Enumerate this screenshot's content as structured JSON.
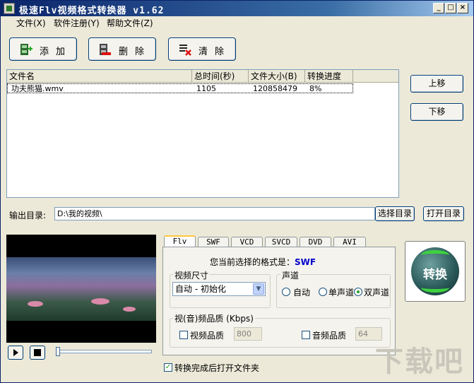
{
  "window": {
    "title": "极速Flv视频格式转换器 v1.62",
    "controls": {
      "minimize": "_",
      "maximize": "□",
      "close": "×"
    }
  },
  "menu": [
    {
      "label": "文件(X)"
    },
    {
      "label": "软件注册(Y)"
    },
    {
      "label": "帮助文件(Z)"
    }
  ],
  "toolbar": {
    "add_label": "添加",
    "delete_label": "删除",
    "clear_label": "清除",
    "add_icon": "film-add-icon",
    "delete_icon": "film-delete-icon",
    "clear_icon": "clear-list-icon"
  },
  "file_list": {
    "columns": [
      "文件名",
      "总时间(秒)",
      "文件大小(B)",
      "转换进度"
    ],
    "rows": [
      {
        "name": "功夫熊猫.wmv",
        "duration": "1105",
        "size": "120858479",
        "progress": "8%"
      }
    ]
  },
  "side_buttons": {
    "move_up": "上移",
    "move_down": "下移"
  },
  "output": {
    "label": "输出目录:",
    "path": "D:\\我的视频\\",
    "choose_dir": "选择目录",
    "open_dir": "打开目录"
  },
  "tabs": [
    {
      "label": "Flv",
      "active": true
    },
    {
      "label": "SWF",
      "active": false
    },
    {
      "label": "VCD",
      "active": false
    },
    {
      "label": "SVCD",
      "active": false
    },
    {
      "label": "DVD",
      "active": false
    },
    {
      "label": "AVI",
      "active": false
    }
  ],
  "format_panel": {
    "current_format_label": "您当前选择的格式是：",
    "current_format": "SWF",
    "video_size_title": "视频尺寸",
    "video_size_value": "自动 - 初始化",
    "channel_title": "声道",
    "channel_options": [
      {
        "label": "自动",
        "checked": false
      },
      {
        "label": "单声道",
        "checked": false
      },
      {
        "label": "双声道",
        "checked": true
      }
    ],
    "quality_title": "视(音)频品质 (Kbps)",
    "video_quality_label": "视频品质",
    "video_quality_value": "800",
    "audio_quality_label": "音频品质",
    "audio_quality_value": "64"
  },
  "convert_button": {
    "label": "转换",
    "icon": "convert-orb-icon"
  },
  "open_after": {
    "label": "转换完成后打开文件夹",
    "checked": true
  },
  "player": {
    "play_icon": "play-icon",
    "stop_icon": "stop-icon",
    "position": 0
  },
  "watermark": {
    "text": "下载吧"
  },
  "colors": {
    "title_bar": "#0a246a",
    "active_tab_accent": "#ffc83c",
    "format_value": "#0000cc"
  }
}
